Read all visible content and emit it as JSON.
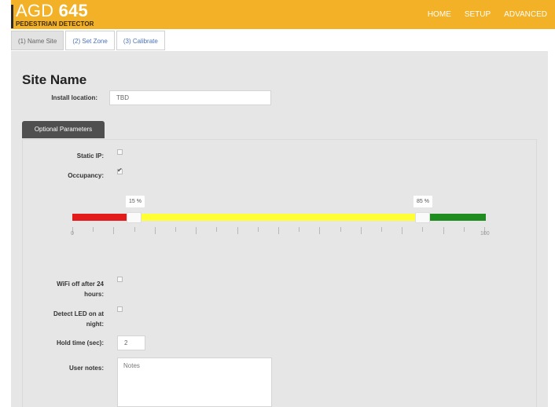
{
  "header": {
    "brand_thin": "AGD ",
    "brand_bold": "645",
    "brand_sub": "PEDESTRIAN DETECTOR",
    "nav": [
      "HOME",
      "SETUP",
      "ADVANCED"
    ]
  },
  "tabs": [
    {
      "label": "(1) Name Site",
      "active": true
    },
    {
      "label": "(2) Set Zone",
      "active": false
    },
    {
      "label": "(3) Calibrate",
      "active": false
    }
  ],
  "page_title": "Site Name",
  "install_location": {
    "label": "Install location:",
    "value": "TBD"
  },
  "optional_params_label": "Optional Parameters",
  "static_ip": {
    "label": "Static IP:",
    "checked": false
  },
  "occupancy": {
    "label": "Occupancy:",
    "checked": true
  },
  "slider": {
    "min": 0,
    "max": 100,
    "low": 15,
    "high": 85,
    "low_label": "15 %",
    "high_label": "85 %",
    "min_label": "0",
    "max_label": "100",
    "colors": {
      "low": "#e31b1b",
      "mid": "#ffff33",
      "high": "#1e8c1e"
    }
  },
  "wifi_off": {
    "label": "WiFi off after 24 hours:",
    "checked": false
  },
  "detect_led": {
    "label": "Detect LED on at night:",
    "checked": false
  },
  "hold_time": {
    "label": "Hold time (sec):",
    "value": "2"
  },
  "user_notes": {
    "label": "User notes:",
    "value": "Notes"
  },
  "colors": {
    "header": "#f2b126",
    "panel": "#e6e6e6",
    "button": "#4f4f4f"
  }
}
